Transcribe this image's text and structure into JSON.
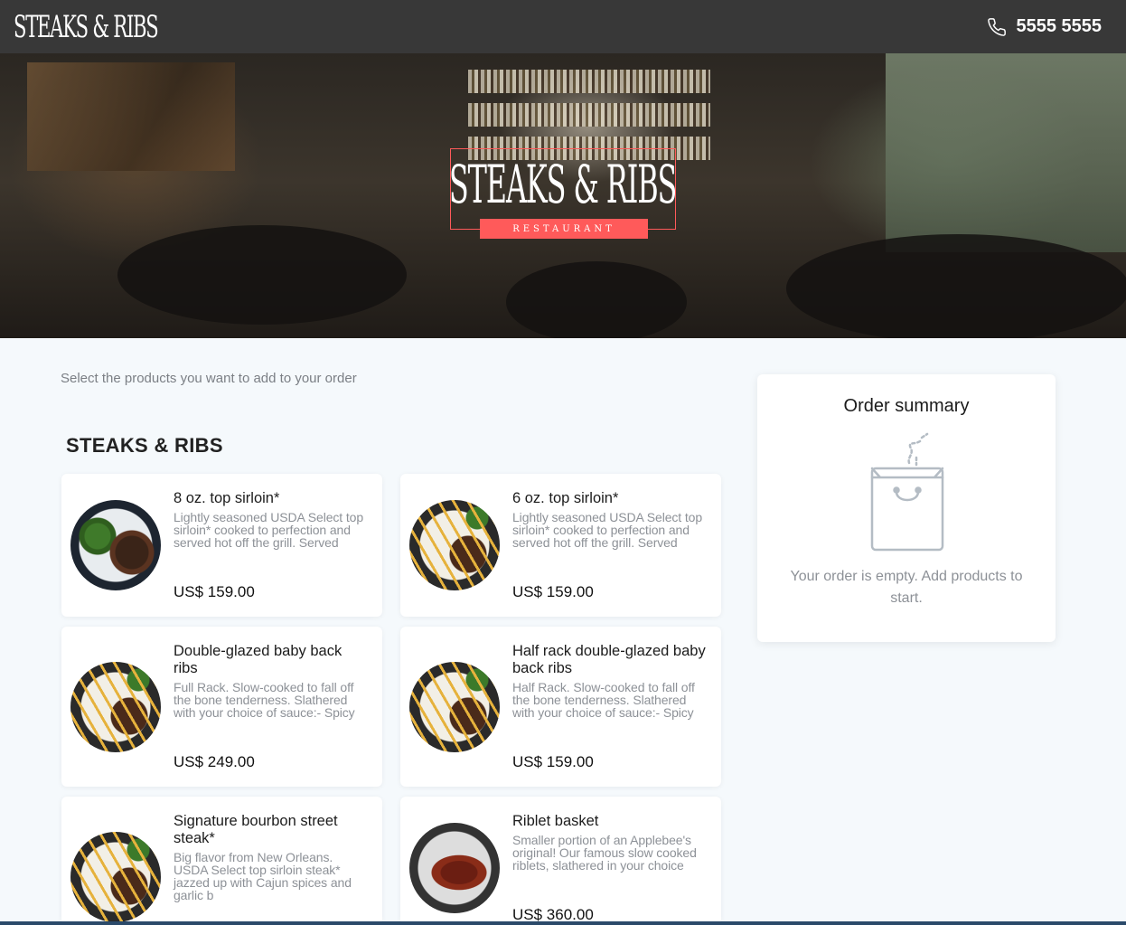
{
  "header": {
    "logo": "STEAKS & RIBS",
    "phone_icon": "phone-icon",
    "phone": "5555 5555"
  },
  "hero": {
    "title": "STEAKS & RIBS",
    "subtitle": "RESTAURANT",
    "accent_color": "#ff5a5a"
  },
  "main": {
    "instructions": "Select the products you want to add to your order",
    "section_title": "STEAKS & RIBS",
    "products": [
      {
        "name": "8 oz. top sirloin*",
        "description": "Lightly seasoned USDA Select top sirloin* cooked to perfection and served hot off the grill. Served",
        "price": "US$ 159.00"
      },
      {
        "name": "6 oz. top sirloin*",
        "description": "Lightly seasoned USDA Select top sirloin* cooked to perfection and served hot off the grill. Served",
        "price": "US$ 159.00"
      },
      {
        "name": "Double-glazed baby back ribs",
        "description": "Full Rack. Slow-cooked to fall off the bone tenderness. Slathered with your choice of sauce:- Spicy",
        "price": "US$ 249.00"
      },
      {
        "name": "Half rack double-glazed baby back ribs",
        "description": "Half Rack. Slow-cooked to fall off the bone tenderness. Slathered with your choice of sauce:- Spicy",
        "price": "US$ 159.00"
      },
      {
        "name": "Signature bourbon street steak*",
        "description": "Big flavor from New Orleans. USDA Select top sirloin steak* jazzed up with Cajun spices and garlic b",
        "price": ""
      },
      {
        "name": "Riblet basket",
        "description": "Smaller portion of an Applebee's original! Our famous slow cooked riblets, slathered in your choice",
        "price": "US$ 360.00"
      }
    ]
  },
  "summary": {
    "title": "Order summary",
    "icon": "shopping-bag-icon",
    "empty_message": "Your order is empty. Add products to start."
  }
}
